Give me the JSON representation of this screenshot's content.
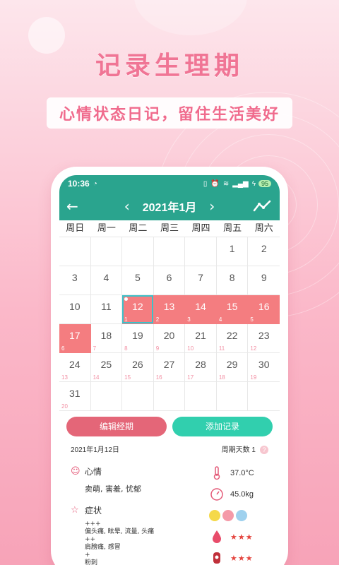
{
  "headline": "记录生理期",
  "subline": "心情状态日记，留住生活美好",
  "status_bar": {
    "time": "10:36",
    "battery": "95"
  },
  "header": {
    "month_title": "2021年1月"
  },
  "weekdays": [
    "周日",
    "周一",
    "周二",
    "周三",
    "周四",
    "周五",
    "周六"
  ],
  "calendar": [
    {
      "day": "",
      "p": ""
    },
    {
      "day": "",
      "p": ""
    },
    {
      "day": "",
      "p": ""
    },
    {
      "day": "",
      "p": ""
    },
    {
      "day": "",
      "p": ""
    },
    {
      "day": "1",
      "p": ""
    },
    {
      "day": "2",
      "p": ""
    },
    {
      "day": "3",
      "p": ""
    },
    {
      "day": "4",
      "p": ""
    },
    {
      "day": "5",
      "p": ""
    },
    {
      "day": "6",
      "p": ""
    },
    {
      "day": "7",
      "p": ""
    },
    {
      "day": "8",
      "p": ""
    },
    {
      "day": "9",
      "p": ""
    },
    {
      "day": "10",
      "p": ""
    },
    {
      "day": "11",
      "p": ""
    },
    {
      "day": "12",
      "p": "1",
      "period": true,
      "today": true
    },
    {
      "day": "13",
      "p": "2",
      "period": true
    },
    {
      "day": "14",
      "p": "3",
      "period": true
    },
    {
      "day": "15",
      "p": "4",
      "period": true
    },
    {
      "day": "16",
      "p": "5",
      "period": true
    },
    {
      "day": "17",
      "p": "6",
      "period": true
    },
    {
      "day": "18",
      "p": "7"
    },
    {
      "day": "19",
      "p": "8"
    },
    {
      "day": "20",
      "p": "9"
    },
    {
      "day": "21",
      "p": "10"
    },
    {
      "day": "22",
      "p": "11"
    },
    {
      "day": "23",
      "p": "12"
    },
    {
      "day": "24",
      "p": "13"
    },
    {
      "day": "25",
      "p": "14"
    },
    {
      "day": "26",
      "p": "15"
    },
    {
      "day": "27",
      "p": "16"
    },
    {
      "day": "28",
      "p": "17"
    },
    {
      "day": "29",
      "p": "18"
    },
    {
      "day": "30",
      "p": "19"
    },
    {
      "day": "31",
      "p": "20"
    },
    {
      "day": "",
      "p": ""
    },
    {
      "day": "",
      "p": ""
    },
    {
      "day": "",
      "p": ""
    },
    {
      "day": "",
      "p": ""
    },
    {
      "day": "",
      "p": ""
    },
    {
      "day": "",
      "p": ""
    }
  ],
  "buttons": {
    "edit": "编辑经期",
    "add": "添加记录"
  },
  "info": {
    "date": "2021年1月12日",
    "period_days": "周期天数 1",
    "help": "?"
  },
  "mood": {
    "title": "心情",
    "value": "卖萌, 害羞, 忧郁"
  },
  "symptoms": {
    "title": "症状",
    "lines": [
      "+++",
      "偏头痛, 眩晕, 流量, 头痛",
      "++",
      "肩膀痛, 感冒",
      "+",
      "粉刺"
    ]
  },
  "metrics": {
    "temperature": "37.0°C",
    "weight": "45.0kg",
    "flow_stars": "★★★",
    "pain_stars": "★★★"
  },
  "colors": {
    "primary": "#2aa48e",
    "period": "#f47d80",
    "today_border": "#3cc1c9",
    "edit_button": "#e46678",
    "add_button": "#31cfae"
  }
}
